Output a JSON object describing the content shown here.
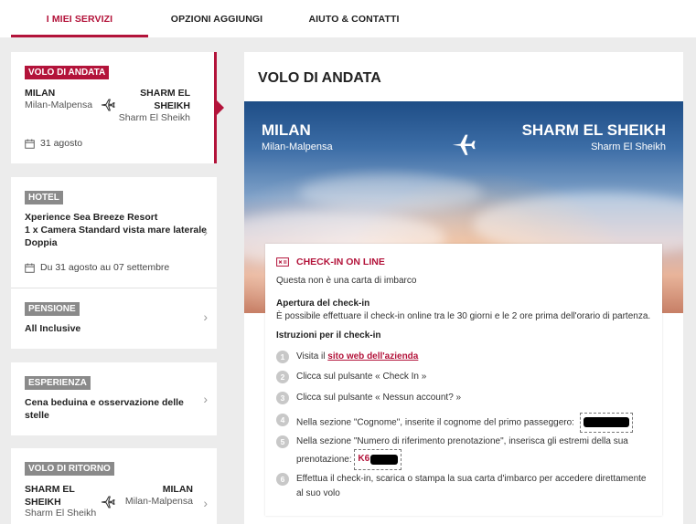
{
  "topnav": {
    "tabs": [
      {
        "label": "I MIEI SERVIZI",
        "active": true
      },
      {
        "label": "OPZIONI AGGIUNGI",
        "active": false
      },
      {
        "label": "AIUTO & CONTATTI",
        "active": false
      }
    ]
  },
  "sidebar": {
    "outbound": {
      "badge": "VOLO DI ANDATA",
      "from_city": "MILAN",
      "from_airport": "Milan-Malpensa",
      "to_city_line1": "SHARM EL",
      "to_city_line2": "SHEIKH",
      "to_airport": "Sharm El Sheikh",
      "date": "31 agosto"
    },
    "hotel": {
      "badge": "HOTEL",
      "name": "Xperience Sea Breeze Resort",
      "room_line1": "1 x Camera Standard vista mare laterale",
      "room_line2": "Doppia",
      "dates": "Du 31 agosto au 07 settembre"
    },
    "board": {
      "badge": "PENSIONE",
      "value": "All Inclusive"
    },
    "experience": {
      "badge": "ESPERIENZA",
      "line1": "Cena beduina e osservazione delle",
      "line2": "stelle"
    },
    "return": {
      "badge": "VOLO DI RITORNO",
      "from_city_line1": "SHARM EL",
      "from_city_line2": "SHEIKH",
      "from_airport": "Sharm El Sheikh",
      "to_city": "MILAN",
      "to_airport": "Milan-Malpensa"
    }
  },
  "main": {
    "title": "VOLO DI ANDATA",
    "hero": {
      "from_city": "MILAN",
      "from_airport": "Milan-Malpensa",
      "to_city": "SHARM EL SHEIKH",
      "to_airport": "Sharm El Sheikh"
    },
    "checkin": {
      "heading": "CHECK-IN ON LINE",
      "note": "Questa non è una carta di imbarco",
      "opening_title": "Apertura del check-in",
      "opening_text": "È possibile effettuare il check-in online tra le 30 giorni e le 2 ore prima dell'orario di partenza.",
      "instructions_title": "Istruzioni per il check-in",
      "steps": [
        {
          "n": "1",
          "text": "Visita il ",
          "link": "sito web dell'azienda"
        },
        {
          "n": "2",
          "text": "Clicca sul pulsante « Check In »"
        },
        {
          "n": "3",
          "text": "Clicca sul pulsante « Nessun account? »"
        },
        {
          "n": "4",
          "text": "Nella sezione \"Cognome\", inserite il cognome del primo passeggero:"
        },
        {
          "n": "5",
          "text_line1": "Nella sezione \"Numero di riferimento prenotazione\", inserisca gli estremi della sua",
          "text_line2": "prenotazione:",
          "ref_prefix": "K6"
        },
        {
          "n": "6",
          "text_line1": "Effettua il check-in, scarica o stampa la sua carta d'imbarco per accedere direttamente",
          "text_line2": "al suo volo"
        }
      ]
    }
  },
  "colors": {
    "accent": "#b3133a",
    "badge_grey": "#8a8a8a"
  }
}
